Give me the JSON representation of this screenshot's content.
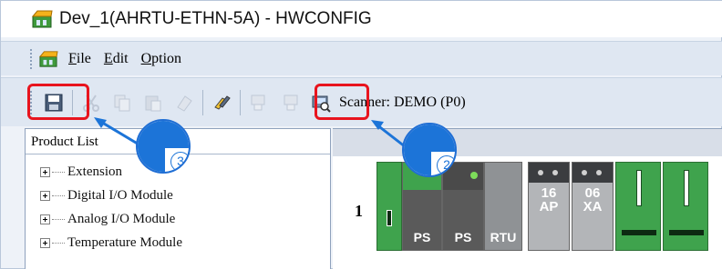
{
  "window": {
    "title": "Dev_1(AHRTU-ETHN-5A) - HWCONFIG"
  },
  "menu": {
    "items": [
      {
        "label_pre": "",
        "label_ul": "F",
        "label_post": "ile"
      },
      {
        "label_pre": "",
        "label_ul": "E",
        "label_post": "dit"
      },
      {
        "label_pre": "",
        "label_ul": "O",
        "label_post": "ption"
      }
    ]
  },
  "toolbar": {
    "scanner_label": "Scanner: DEMO (P0)",
    "icons": [
      "save-icon",
      "cut-icon",
      "copy-icon",
      "paste-icon",
      "erase-icon",
      "link-icon",
      "upload-icon",
      "download-icon",
      "scan-icon"
    ]
  },
  "product_list": {
    "header": "Product List",
    "items": [
      {
        "label": "Extension"
      },
      {
        "label": "Digital I/O Module"
      },
      {
        "label": "Analog I/O Module"
      },
      {
        "label": "Temperature Module"
      }
    ]
  },
  "rack": {
    "row_number": "1",
    "modules": [
      {
        "type": "green-left",
        "label": ""
      },
      {
        "type": "ps",
        "label": "PS"
      },
      {
        "type": "ps",
        "label": "PS"
      },
      {
        "type": "rtu",
        "label": "RTU"
      },
      {
        "type": "io",
        "line1": "16",
        "line2": "AP"
      },
      {
        "type": "io",
        "line1": "06",
        "line2": "XA"
      },
      {
        "type": "green",
        "label": ""
      },
      {
        "type": "green",
        "label": ""
      }
    ]
  },
  "markers": {
    "marker_3": "3",
    "marker_2": "2"
  },
  "colors": {
    "highlight": "#e8141e",
    "marker_blue": "#1c74d8",
    "module_green": "#3fa34d"
  }
}
